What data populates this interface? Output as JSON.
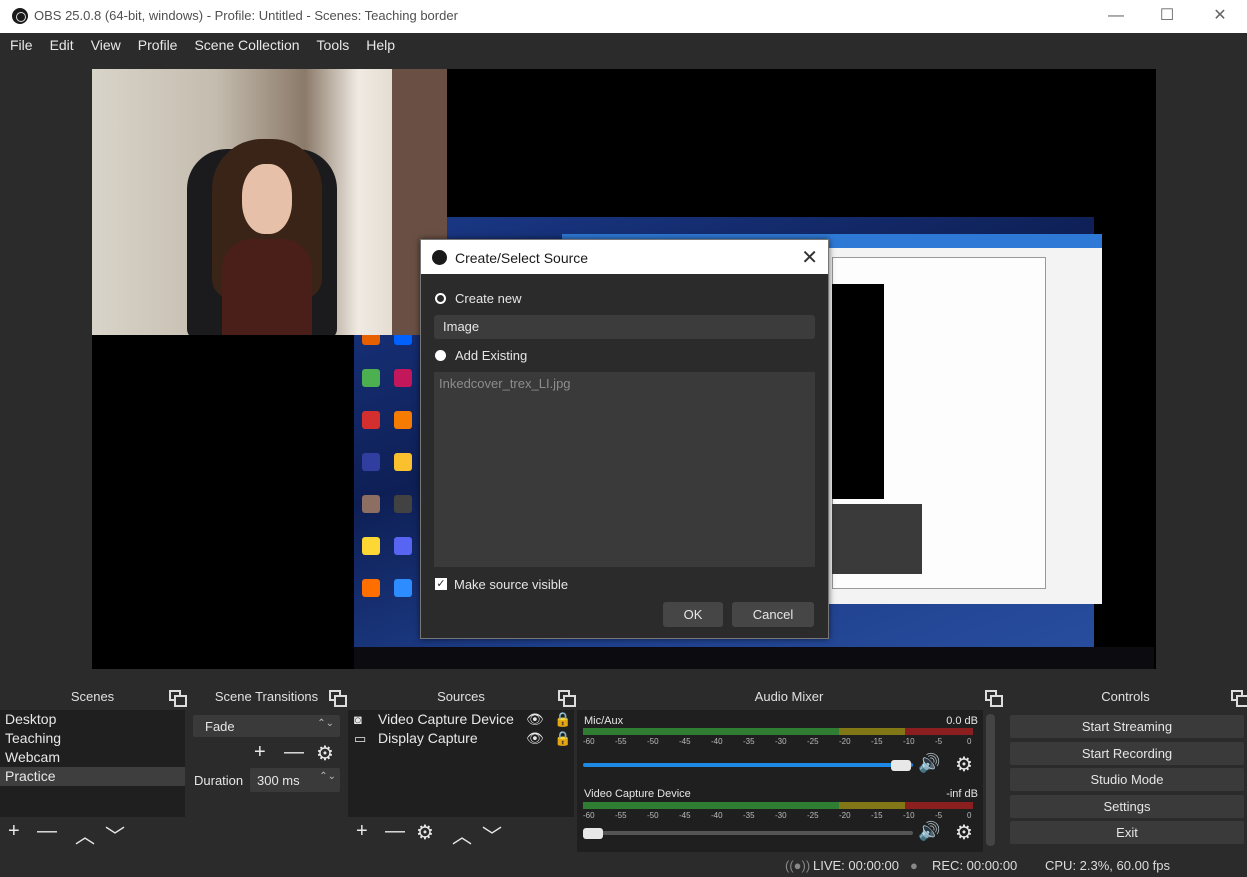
{
  "window": {
    "title": "OBS 25.0.8 (64-bit, windows) - Profile: Untitled - Scenes: Teaching border",
    "minimize": "—",
    "maximize": "☐",
    "close": "✕"
  },
  "menu": [
    "File",
    "Edit",
    "View",
    "Profile",
    "Scene Collection",
    "Tools",
    "Help"
  ],
  "dialog": {
    "title": "Create/Select Source",
    "close": "✕",
    "create_new_label": "Create new",
    "create_new_selected": true,
    "name_value": "Image",
    "add_existing_label": "Add Existing",
    "existing_items": [
      "Inkedcover_trex_LI.jpg"
    ],
    "make_visible_label": "Make source visible",
    "make_visible_checked": true,
    "ok_label": "OK",
    "cancel_label": "Cancel"
  },
  "scenes": {
    "header": "Scenes",
    "items": [
      "Desktop",
      "Teaching",
      "Webcam",
      "Practice"
    ],
    "selected_index": 3,
    "toolbar": [
      "+",
      "—",
      "︿",
      "﹀"
    ]
  },
  "transitions": {
    "header": "Scene Transitions",
    "transition_value": "Fade",
    "duration_label": "Duration",
    "duration_value": "300 ms",
    "toolbar": [
      "+",
      "—",
      "⚙"
    ]
  },
  "sources": {
    "header": "Sources",
    "items": [
      {
        "name": "Video Capture Device",
        "icon": "camera-icon"
      },
      {
        "name": "Display Capture",
        "icon": "monitor-icon"
      }
    ],
    "toolbar": [
      "+",
      "—",
      "⚙",
      "︿",
      "﹀"
    ]
  },
  "audio": {
    "header": "Audio Mixer",
    "channels": [
      {
        "name": "Mic/Aux",
        "level": "0.0 dB",
        "volume_fraction": 1.0
      },
      {
        "name": "Video Capture Device",
        "level": "-inf dB",
        "volume_fraction": 0.0
      }
    ],
    "ticks": [
      "-60",
      "-55",
      "-50",
      "-45",
      "-40",
      "-35",
      "-30",
      "-25",
      "-20",
      "-15",
      "-10",
      "-5",
      "0"
    ],
    "speaker_glyph": "🔊",
    "gear_glyph": "⚙"
  },
  "controls": {
    "header": "Controls",
    "buttons": [
      "Start Streaming",
      "Start Recording",
      "Studio Mode",
      "Settings",
      "Exit"
    ]
  },
  "status": {
    "live": "LIVE: 00:00:00",
    "rec": "REC: 00:00:00",
    "cpu": "CPU: 2.3%, 60.00 fps"
  },
  "colors": {
    "accent": "#1e88e5",
    "meter_green": "#2e7d32",
    "meter_yellow": "#827717",
    "meter_red": "#8b1e1e"
  }
}
